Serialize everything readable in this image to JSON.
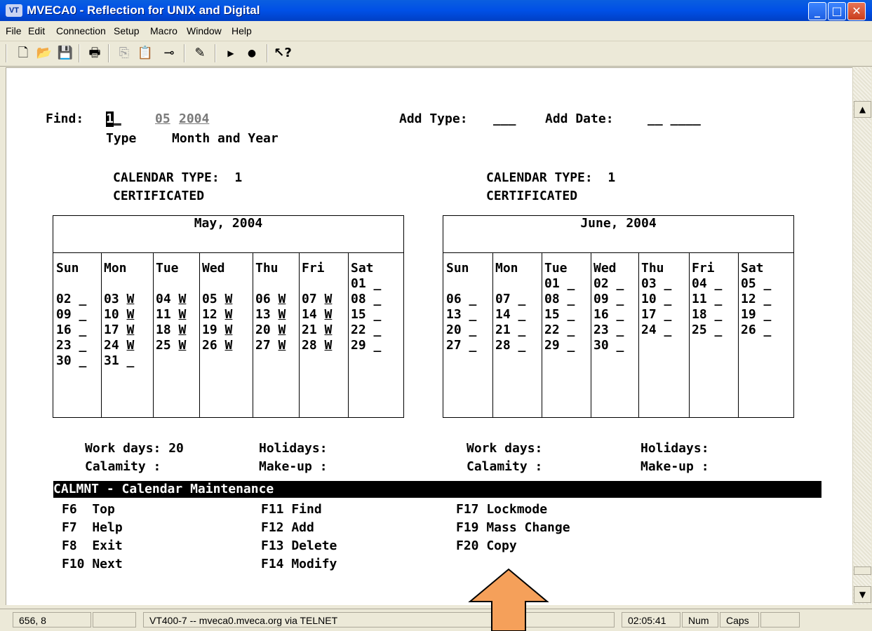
{
  "window": {
    "app_icon": "VT",
    "title": "MVECA0 - Reflection for UNIX and Digital",
    "min": "_",
    "max": "□",
    "close": "✕"
  },
  "menu": [
    "File",
    "Edit",
    "Connection",
    "Setup",
    "Macro",
    "Window",
    "Help"
  ],
  "toolbar_icons": [
    "new-icon",
    "open-icon",
    "save-icon",
    "print-icon",
    "copy-icon",
    "paste-icon",
    "connect-icon",
    "edit-icon",
    "play-icon",
    "record-icon",
    "help-icon"
  ],
  "screen": {
    "find_label": "Find:",
    "find_value": "1",
    "find_type_label": "Type",
    "month": "05",
    "year": "2004",
    "month_year_label": "Month and Year",
    "add_type_label": "Add Type:",
    "add_type_value": "___",
    "add_date_label": "Add Date:",
    "add_date_value": "__ ____"
  },
  "calendars": [
    {
      "cal_type_label": "CALENDAR TYPE:  1",
      "cal_type_name": "CERTIFICATED",
      "title": "May, 2004",
      "dow": [
        "Sun",
        "Mon",
        "Tue",
        "Wed",
        "Thu",
        "Fri",
        "Sat"
      ],
      "rows": [
        [
          "",
          "",
          "",
          "",
          "",
          "",
          "01 _"
        ],
        [
          "02 _",
          "03 W",
          "04 W",
          "05 W",
          "06 W",
          "07 W",
          "08 _"
        ],
        [
          "09 _",
          "10 W",
          "11 W",
          "12 W",
          "13 W",
          "14 W",
          "15 _"
        ],
        [
          "16 _",
          "17 W",
          "18 W",
          "19 W",
          "20 W",
          "21 W",
          "22 _"
        ],
        [
          "23 _",
          "24 W",
          "25 W",
          "26 W",
          "27 W",
          "28 W",
          "29 _"
        ],
        [
          "30 _",
          "31 _",
          "",
          "",
          "",
          "",
          ""
        ]
      ],
      "work_days": "Work days: 20",
      "holidays": "Holidays:",
      "calamity": "Calamity :",
      "makeup": "Make-up :"
    },
    {
      "cal_type_label": "CALENDAR TYPE:  1",
      "cal_type_name": "CERTIFICATED",
      "title": "June, 2004",
      "dow": [
        "Sun",
        "Mon",
        "Tue",
        "Wed",
        "Thu",
        "Fri",
        "Sat"
      ],
      "rows": [
        [
          "",
          "",
          "01 _",
          "02 _",
          "03 _",
          "04 _",
          "05 _"
        ],
        [
          "06 _",
          "07 _",
          "08 _",
          "09 _",
          "10 _",
          "11 _",
          "12 _"
        ],
        [
          "13 _",
          "14 _",
          "15 _",
          "16 _",
          "17 _",
          "18 _",
          "19 _"
        ],
        [
          "20 _",
          "21 _",
          "22 _",
          "23 _",
          "24 _",
          "25 _",
          "26 _"
        ],
        [
          "27 _",
          "28 _",
          "29 _",
          "30 _",
          "",
          "",
          ""
        ],
        [
          "",
          "",
          "",
          "",
          "",
          "",
          ""
        ]
      ],
      "work_days": "Work days:",
      "holidays": "Holidays:",
      "calamity": "Calamity :",
      "makeup": "Make-up :"
    }
  ],
  "program_bar": "CALMNT - Calendar Maintenance",
  "fkeys": {
    "col1": [
      "F6  Top",
      "F7  Help",
      "F8  Exit",
      "F10 Next"
    ],
    "col2": [
      "F11 Find",
      "F12 Add",
      "F13 Delete",
      "F14 Modify"
    ],
    "col3": [
      "F17 Lockmode",
      "F19 Mass Change",
      "F20 Copy"
    ]
  },
  "status": {
    "cursor_pos": "656, 8",
    "connection": "VT400-7 -- mveca0.mveca.org via TELNET",
    "time": "02:05:41",
    "num": "Num",
    "caps": "Caps"
  },
  "arrow_color": "#f5a05a"
}
